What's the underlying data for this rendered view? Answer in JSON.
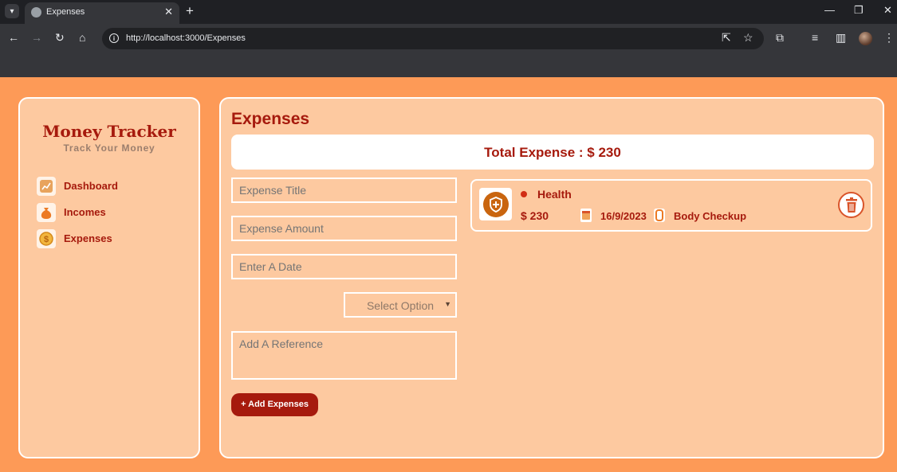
{
  "browser": {
    "tab_title": "Expenses",
    "tab_close": "✕",
    "new_tab": "+",
    "url": "http://localhost:3000/Expenses"
  },
  "sidebar": {
    "brand": "Money Tracker",
    "tagline": "Track Your Money",
    "items": [
      {
        "label": "Dashboard",
        "icon": "chart-icon"
      },
      {
        "label": "Incomes",
        "icon": "money-bag-icon"
      },
      {
        "label": "Expenses",
        "icon": "coin-icon"
      }
    ]
  },
  "main": {
    "title": "Expenses",
    "total_label": "Total Expense : $ 230",
    "form": {
      "title_placeholder": "Expense Title",
      "amount_placeholder": "Expense Amount",
      "date_placeholder": "Enter A Date",
      "select_value": "Select Option",
      "reference_placeholder": "Add A Reference",
      "submit_label": "+ Add Expenses"
    },
    "items": [
      {
        "category": "Health",
        "amount": "$ 230",
        "date": "16/9/2023",
        "reference": "Body Checkup"
      }
    ]
  },
  "colors": {
    "accent": "#a61a0d",
    "page_bg": "#fd9a57",
    "panel_bg": "#fdc9a0",
    "status_dot": "#d12d14"
  }
}
